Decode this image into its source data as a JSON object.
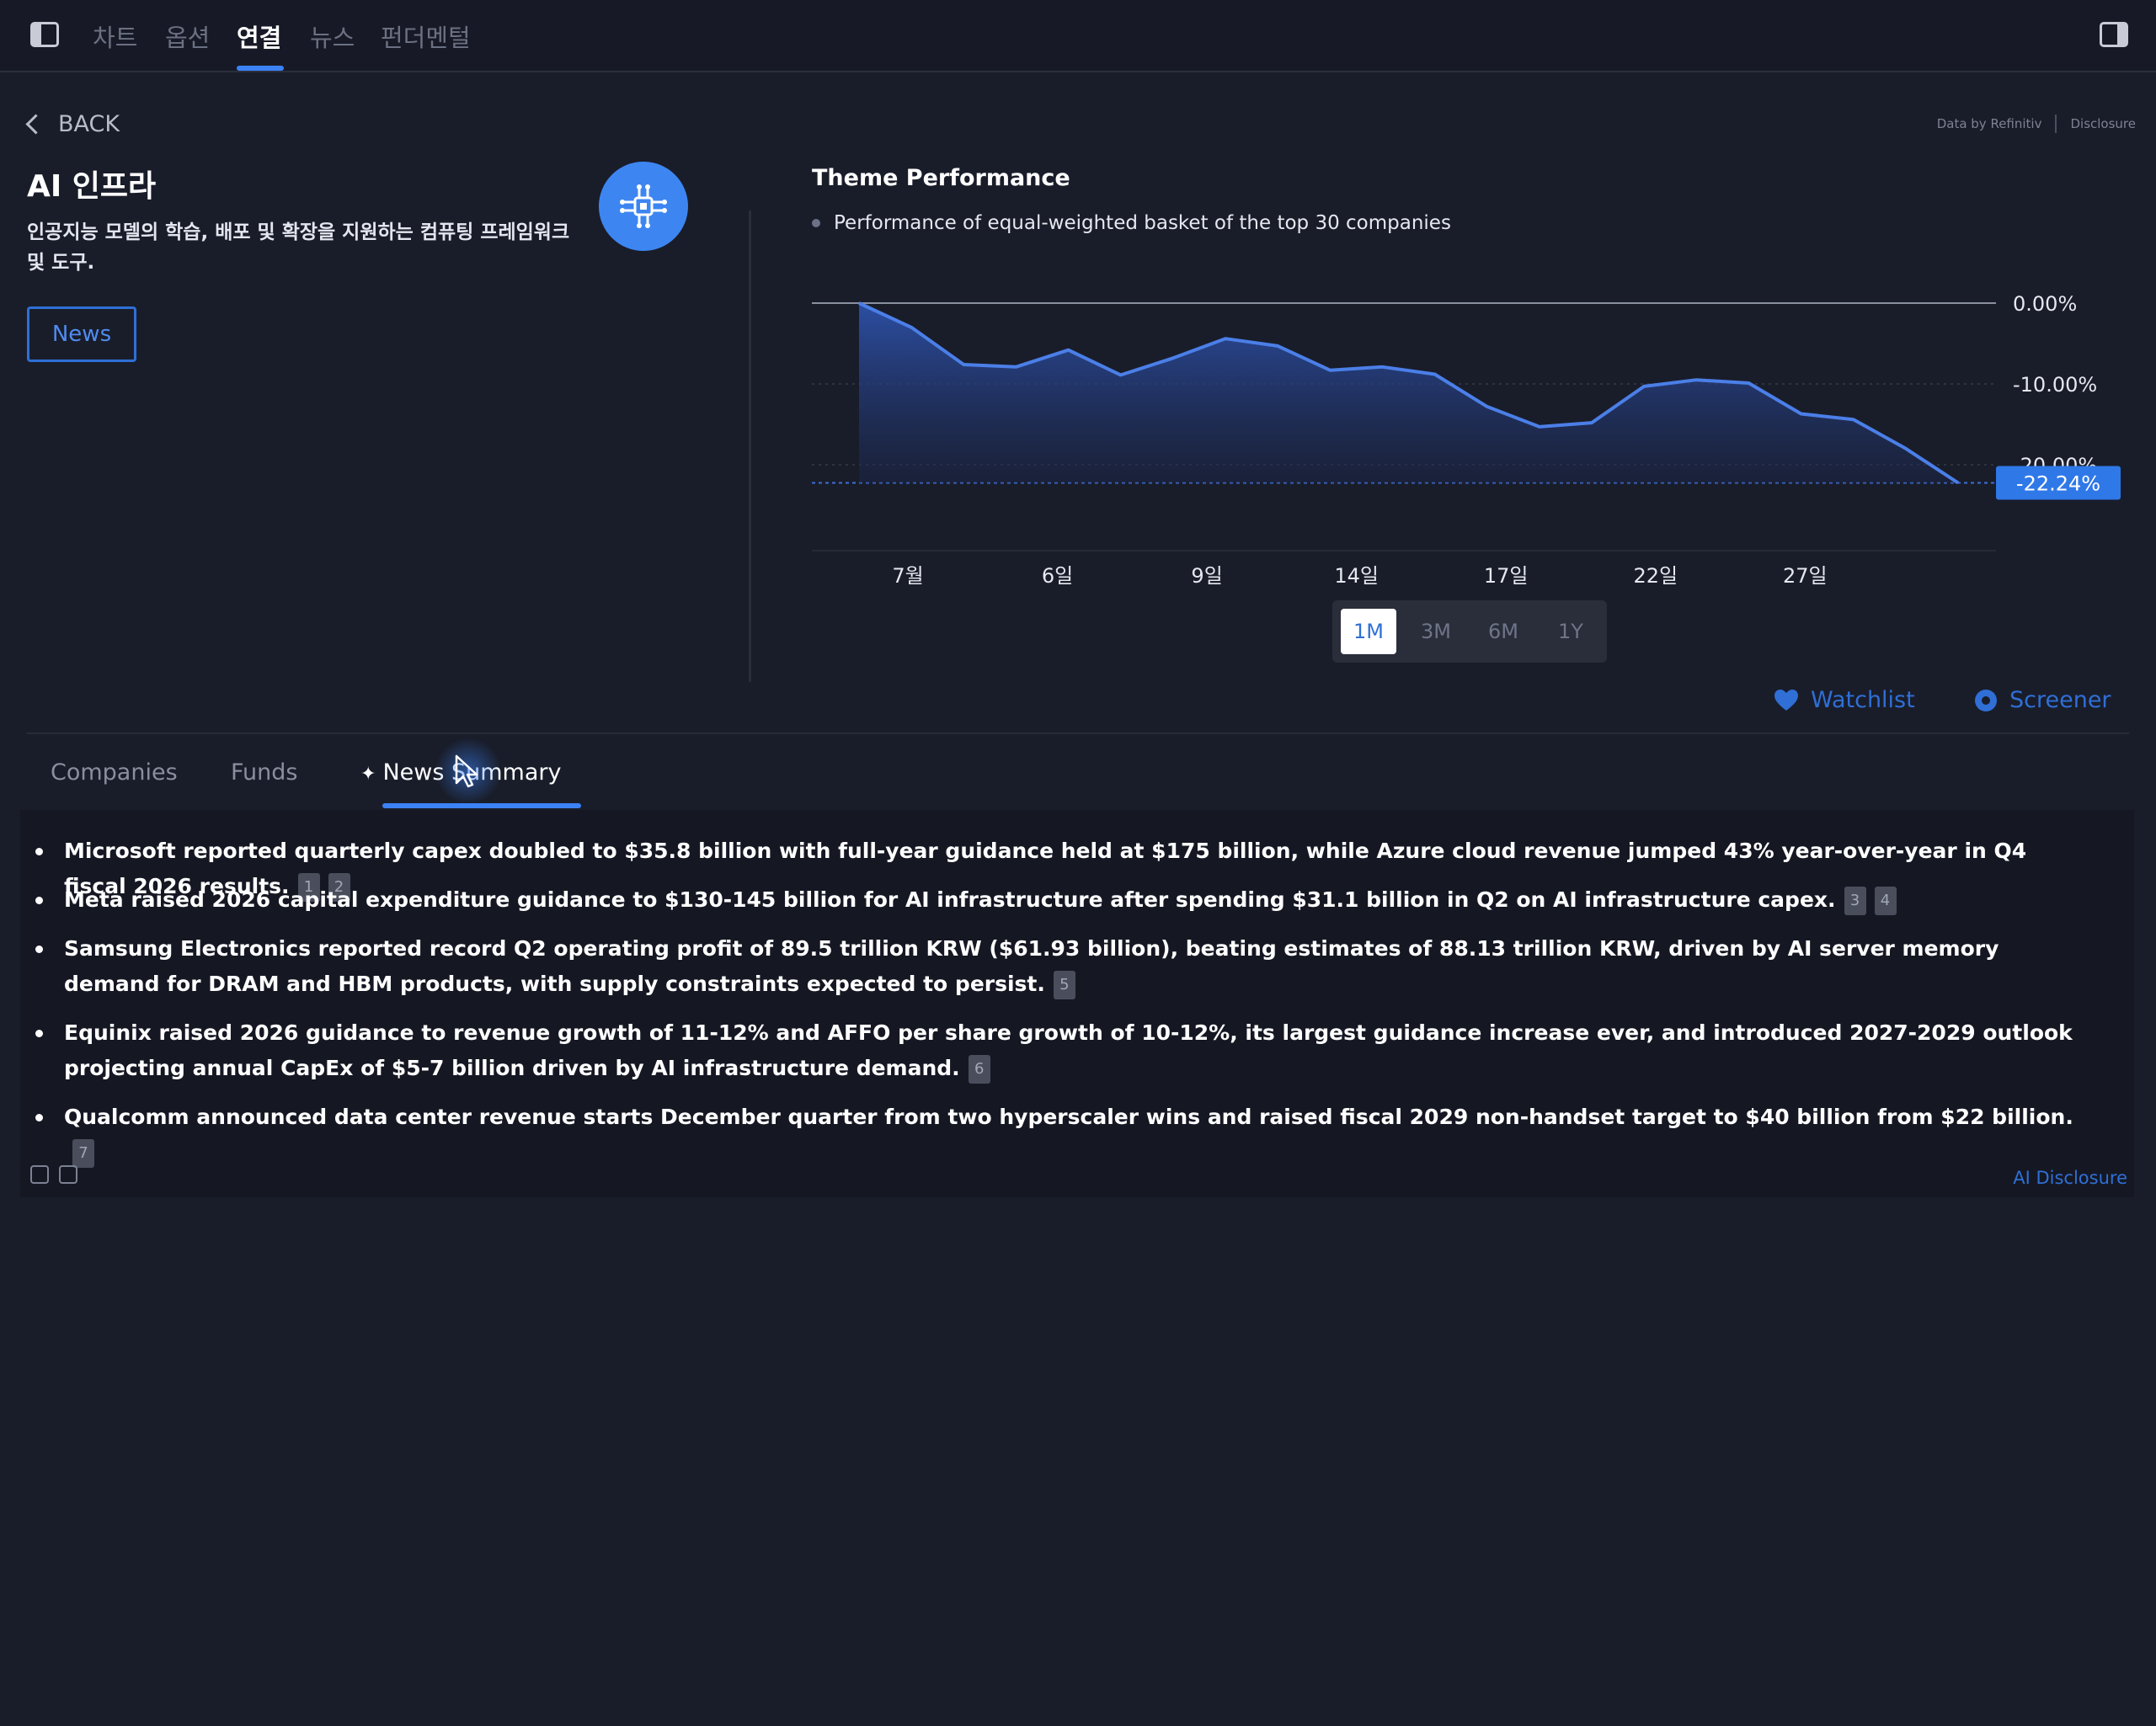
{
  "top_nav": {
    "tabs": [
      {
        "label": "차트"
      },
      {
        "label": "옵션"
      },
      {
        "label": "연결"
      },
      {
        "label": "뉴스"
      },
      {
        "label": "펀더멘털"
      }
    ],
    "active_index": 2
  },
  "back_label": "BACK",
  "attribution": {
    "data_by": "Data by Refinitiv",
    "disclosure": "Disclosure"
  },
  "theme": {
    "title": "AI 인프라",
    "description": "인공지능 모델의 학습, 배포 및 확장을 지원하는 컴퓨팅 프레임워크 및 도구.",
    "news_button": "News",
    "icon": "network-chip-icon"
  },
  "chart_section": {
    "title": "Theme Performance",
    "legend": "Performance of equal-weighted basket of the top 30 companies"
  },
  "chart_data": {
    "type": "area",
    "title": "Theme Performance",
    "x_ticks": [
      "7월",
      "6일",
      "9일",
      "14일",
      "17일",
      "22일",
      "27일"
    ],
    "y_ticks": [
      "0.00%",
      "-10.00%",
      "-20.00%"
    ],
    "ylim": [
      -25,
      0
    ],
    "x": [
      0,
      1,
      2,
      3,
      4,
      5,
      6,
      7,
      8,
      9,
      10,
      11,
      12,
      13,
      14,
      15,
      16,
      17,
      18,
      19,
      20,
      21
    ],
    "values": [
      0,
      -3,
      -7.6,
      -7.9,
      -5.8,
      -8.9,
      -6.8,
      -4.4,
      -5.3,
      -8.3,
      -7.9,
      -8.8,
      -12.8,
      -15.3,
      -14.8,
      -10.3,
      -9.5,
      -9.9,
      -13.7,
      -14.4,
      -18,
      -22.24
    ],
    "last_value_label": "-22.24%",
    "grid": true,
    "color": "#3b6fd4"
  },
  "ranges": {
    "options": [
      "1M",
      "3M",
      "6M",
      "1Y"
    ],
    "active": "1M"
  },
  "actions": {
    "watchlist": "Watchlist",
    "screener": "Screener"
  },
  "section_tabs": [
    {
      "label": "Companies"
    },
    {
      "label": "Funds"
    },
    {
      "label": "News Summary"
    }
  ],
  "summary": [
    {
      "text": "Microsoft reported quarterly capex doubled to $35.8 billion with full-year guidance held at $175 billion, while Azure cloud revenue jumped 43% year-over-year in Q4 fiscal 2026 results.",
      "cites": [
        "1",
        "2"
      ]
    },
    {
      "text": "Meta raised 2026 capital expenditure guidance to $130-145 billion for AI infrastructure after spending $31.1 billion in Q2 on AI infrastructure capex.",
      "cites": [
        "3",
        "4"
      ]
    },
    {
      "text": "Samsung Electronics reported record Q2 operating profit of 89.5 trillion KRW ($61.93 billion), beating estimates of 88.13 trillion KRW, driven by AI server memory demand for DRAM and HBM products, with supply constraints expected to persist.",
      "cites": [
        "5"
      ]
    },
    {
      "text": "Equinix raised 2026 guidance to revenue growth of 11-12% and AFFO per share growth of 10-12%, its largest guidance increase ever, and introduced 2027-2029 outlook projecting annual CapEx of $5-7 billion driven by AI infrastructure demand.",
      "cites": [
        "6"
      ]
    },
    {
      "text": "Qualcomm announced data center revenue starts December quarter from two hyperscaler wins and raised fiscal 2029 non-handset target to $40 billion from $22 billion.",
      "cites": [
        "7"
      ]
    }
  ],
  "footer": {
    "ai_disclosure": "AI Disclosure"
  }
}
